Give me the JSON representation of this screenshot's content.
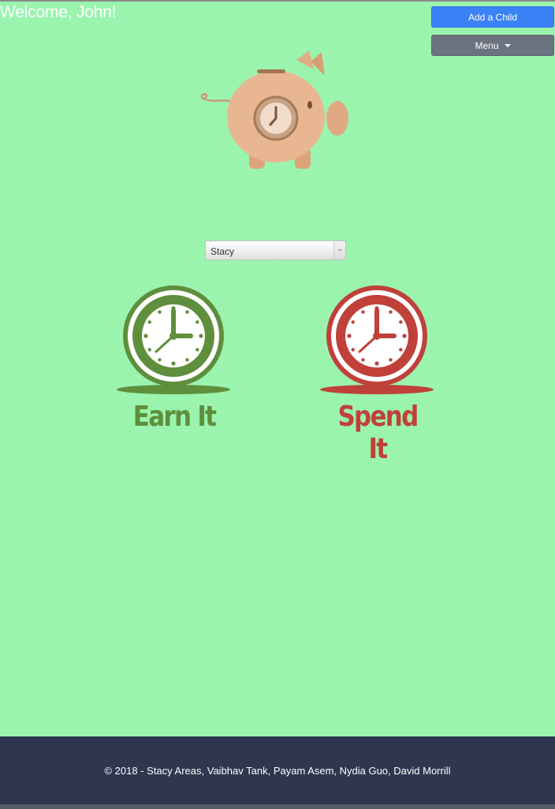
{
  "header": {
    "welcome": "Welcome, John!"
  },
  "buttons": {
    "add_child": "Add a Child",
    "menu": "Menu"
  },
  "child_select": {
    "selected": "Stacy"
  },
  "options": [
    {
      "label": "Earn It",
      "color": "#5f8f3c"
    },
    {
      "label": "Spend It",
      "color": "#c0403a"
    }
  ],
  "footer": {
    "text": "© 2018 - Stacy Areas, Vaibhav Tank, Payam Asem, Nydia Guo, David Morrill"
  },
  "icons": [
    "piggy-bank-icon",
    "earn-clock-icon",
    "spend-clock-icon",
    "chevron-down-icon",
    "caret-down-icon"
  ],
  "colors": {
    "background": "#9af4ae",
    "primary_button": "#3b82f6",
    "menu_button": "#6b7280",
    "footer": "#2f3650",
    "earn": "#5f8f3c",
    "spend": "#c0403a",
    "pig": "#e8b791"
  }
}
